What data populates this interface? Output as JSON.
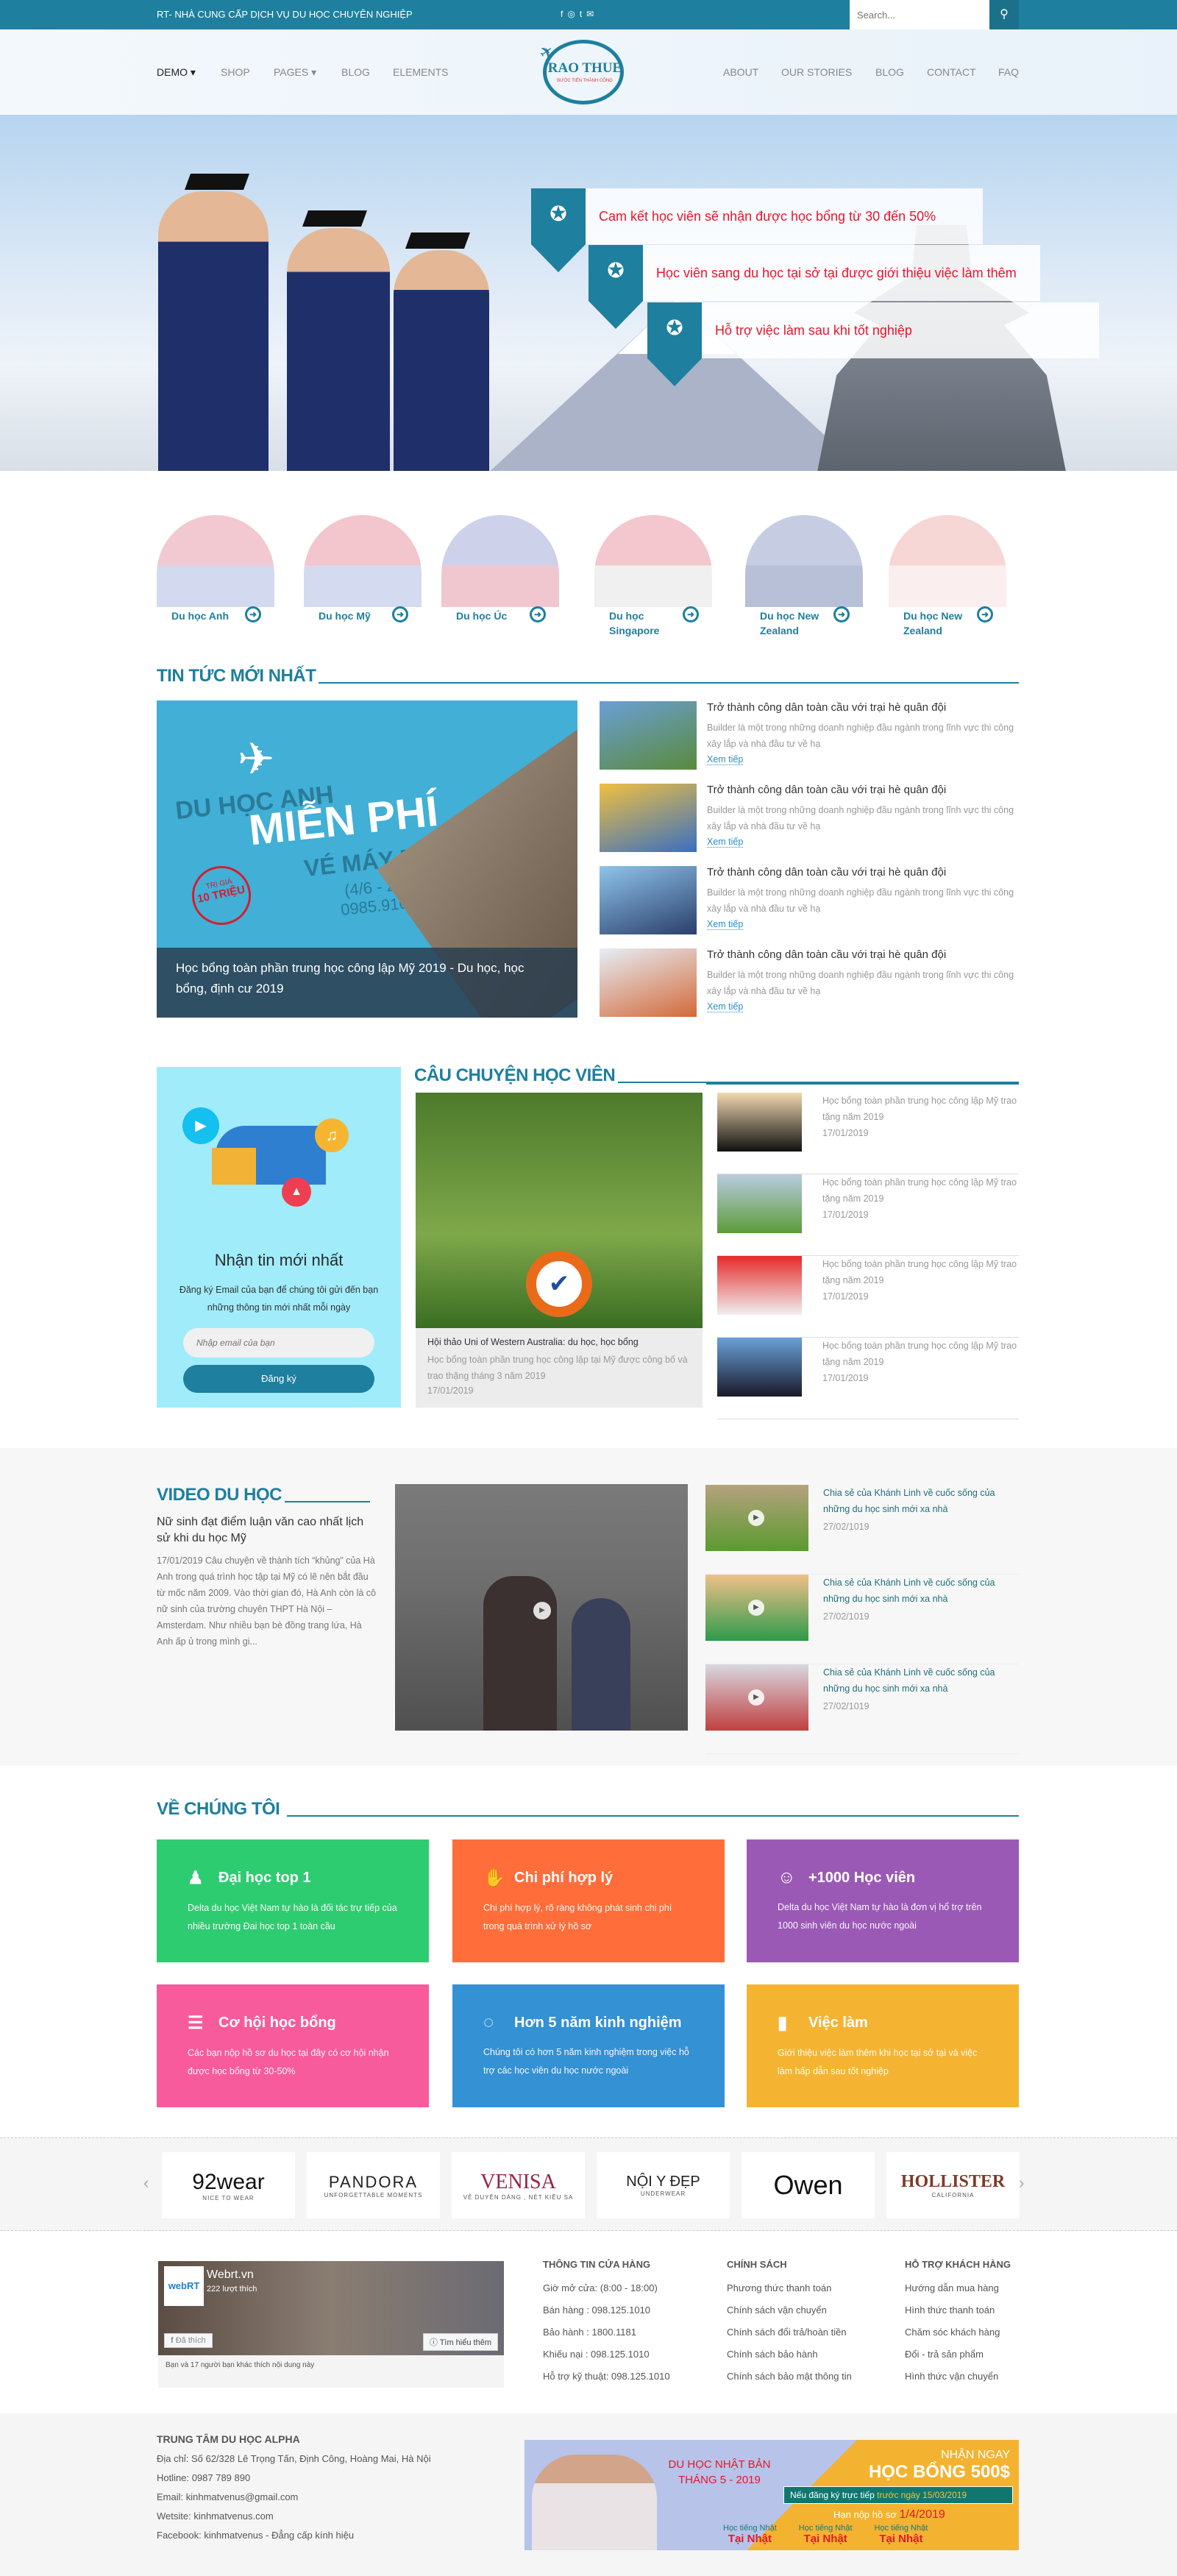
{
  "topbar": {
    "tagline": "RT- NHÀ CUNG CẤP DỊCH VỤ DU HỌC CHUYÊN NGHIỆP",
    "social": [
      "facebook-icon",
      "instagram-icon",
      "twitter-icon",
      "email-icon"
    ],
    "search_placeholder": "Search..."
  },
  "nav": {
    "left": [
      "DEMO",
      "SHOP",
      "PAGES",
      "BLOG",
      "ELEMENTS"
    ],
    "right": [
      "ABOUT",
      "OUR STORIES",
      "BLOG",
      "CONTACT",
      "FAQ"
    ],
    "active": "DEMO"
  },
  "logo": {
    "name": "RAO THUE",
    "slogan": "BƯỚC TIẾN THÀNH CÔNG"
  },
  "hero": {
    "promises": [
      "Cam kết học viên sẽ nhận được học bổng từ 30 đến 50%",
      "Học viên sang du học tại sở tại được giới thiệu việc làm thêm",
      "Hỗ trợ việc làm sau khi tốt nghiệp"
    ]
  },
  "countries": [
    {
      "label": "Du học Anh",
      "colors": [
        "#f2c9d0",
        "#d3d9ee"
      ]
    },
    {
      "label": "Du học Mỹ",
      "colors": [
        "#f3c5cc",
        "#d4daf0"
      ]
    },
    {
      "label": "Du học Úc",
      "colors": [
        "#cdd2ea",
        "#f1c7cf"
      ]
    },
    {
      "label": "Du học Singapore",
      "colors": [
        "#f4c6cd",
        "#f0f0f0"
      ]
    },
    {
      "label": "Du học New Zealand",
      "colors": [
        "#c6cde3",
        "#b8c0d8"
      ]
    },
    {
      "label": "Du học New Zealand",
      "colors": [
        "#f7d6d6",
        "#fbeeee"
      ]
    }
  ],
  "news": {
    "title": "TIN TỨC MỚI NHẤT",
    "featured": {
      "title": "Học bổng toàn phần trung học công lập Mỹ 2019 - Du học, học bổng, định cư 2019",
      "banner": {
        "line1": "DU HỌC ANH",
        "line2": "MIỄN PHÍ",
        "line3": "VÉ MÁY BAY",
        "dates": "(4/6 - 25/6)",
        "phone": "0985.910.334",
        "stamp_top": "TRỊ GIÁ",
        "stamp": "10 TRIỆU"
      }
    },
    "items": [
      {
        "title": "Trở thành công dân toàn cầu với trại hè quân đội",
        "desc": "Builder là một trong những doanh nghiệp đầu ngành trong lĩnh vực thi công xây lắp và nhà đầu tư về hạ",
        "more": "Xem tiếp"
      },
      {
        "title": "Trở thành công dân toàn cầu với trại hè quân đội",
        "desc": "Builder là một trong những doanh nghiệp đầu ngành trong lĩnh vực thi công xây lắp và nhà đầu tư về hạ",
        "more": "Xem tiếp"
      },
      {
        "title": "Trở thành công dân toàn cầu với trại hè quân đội",
        "desc": "Builder là một trong những doanh nghiệp đầu ngành trong lĩnh vực thi công xây lắp và nhà đầu tư về hạ",
        "more": "Xem tiếp"
      },
      {
        "title": "Trở thành công dân toàn cầu với trại hè quân đội",
        "desc": "Builder là một trong những doanh nghiệp đầu ngành trong lĩnh vực thi công xây lắp và nhà đầu tư về hạ",
        "more": "Xem tiếp"
      }
    ]
  },
  "newsletter": {
    "title": "Nhận tin mới nhất",
    "desc": "Đăng ký Email của bạn để chúng tôi gửi đến bạn những thông tin mới nhất mỗi ngày",
    "placeholder": "Nhập email của bạn",
    "button": "Đăng ký"
  },
  "stories": {
    "title": "CÂU CHUYỆN HỌC VIÊN",
    "featured": {
      "title": "Hội thảo Uni of Western Australia: du học, học bổng",
      "desc": "Học bổng toàn phần trung học công lập tại Mỹ được công bố và trao thặng tháng 3 năm 2019",
      "date": "17/01/2019"
    },
    "items": [
      {
        "title": "Học bổng toàn phần trung học công lập Mỹ trao tặng năm 2019",
        "date": "17/01/2019"
      },
      {
        "title": "Học bổng toàn phần trung học công lập Mỹ trao tặng năm 2019",
        "date": "17/01/2019"
      },
      {
        "title": "Học bổng toàn phần trung học công lập Mỹ trao tặng năm 2019",
        "date": "17/01/2019"
      },
      {
        "title": "Học bổng toàn phần trung học công lập Mỹ trao tặng năm 2019",
        "date": "17/01/2019"
      }
    ]
  },
  "video": {
    "title": "VIDEO DU HỌC",
    "headline": "Nữ sinh đạt điểm luận văn cao nhất lịch sử khi du học Mỹ",
    "desc": "17/01/2019 Câu chuyện về thành tích “khủng” của Hà Anh trong quá trình học tập tại Mỹ có lẽ nên bắt đầu từ mốc năm 2009. Vào thời gian đó, Hà Anh còn là cô nữ sinh của trường chuyên THPT Hà Nội – Amsterdam. Như nhiều bạn bè đồng trang lứa, Hà Anh ấp ủ trong mình gi...",
    "items": [
      {
        "title": "Chia sẻ của Khánh Linh về cuốc sống của những du học sinh mới xa nhà",
        "date": "27/02/1019"
      },
      {
        "title": "Chia sẻ của Khánh Linh về cuốc sống của những du học sinh mới xa nhà",
        "date": "27/02/1019"
      },
      {
        "title": "Chia sẻ của Khánh Linh về cuốc sống của những du học sinh mới xa nhà",
        "date": "27/02/1019"
      }
    ]
  },
  "about": {
    "title": "VỀ CHÚNG TÔI",
    "cards": [
      {
        "title": "Đại học top 1",
        "desc": "Delta du học  Việt Nam tự hào là đối tác trự tiếp của nhiều trường Đai học top 1 toàn cầu",
        "icon": "graduate-icon",
        "color": "#2ecc71"
      },
      {
        "title": "Chi phí hợp lý",
        "desc": "Chi phí hợp lý, rõ ràng không phát sinh chi phí trong quá trình xử lý hồ sơ",
        "icon": "payment-icon",
        "color": "#ff6d3a"
      },
      {
        "title": "+1000 Học viên",
        "desc": "Delta du học  Việt Nam tự hào là đơn vị hổ trợ trên 1000 sinh viên du học nước ngoài",
        "icon": "student-reading-icon",
        "color": "#9b59b6"
      },
      {
        "title": "Cơ hội học bổng",
        "desc": "Các bạn nộp hồ sơ du học tại đây có cơ hội nhận được học bổng từ 30-50%",
        "icon": "certificate-icon",
        "color": "#f75b9c"
      },
      {
        "title": "Hơn 5 năm kinh nghiệm",
        "desc": "Chúng tôi có hơn 5 năm kinh nghiệm trong việc hỗ trợ các học viên du học nước ngoài",
        "icon": "ubuntu-icon",
        "color": "#3391d4"
      },
      {
        "title": "Việc làm",
        "desc": "Giới thiệu việc làm thêm khi học tại sở tại và việc làm hấp dẫn sau tốt nghiệp",
        "icon": "growth-chart-icon",
        "color": "#f4b432"
      }
    ]
  },
  "brands": [
    {
      "name": "92wear",
      "sub": "NICE TO WEAR"
    },
    {
      "name": "PANDORA",
      "sub": "UNFORGETTABLE MOMENTS"
    },
    {
      "name": "VENISA",
      "sub": "VẺ DUYÊN DÁNG , NÉT KIỀU SA"
    },
    {
      "name": "NỘI Y ĐẸP",
      "sub": "UNDERWEAR"
    },
    {
      "name": "Owen",
      "sub": ""
    },
    {
      "name": "HOLLISTER",
      "sub": "CALIFORNIA"
    }
  ],
  "facebook": {
    "page": "Webrt.vn",
    "logo": "webRT",
    "likes": "222 lượt thích",
    "liked": "Đã thích",
    "learn_more": "Tìm hiểu thêm",
    "friends": "Bạn và 17 người bạn khác thích nội dung này"
  },
  "footer": {
    "columns": [
      {
        "title": "THÔNG TIN CỬA HÀNG",
        "items": [
          "Giờ mở cửa: (8:00 - 18:00)",
          "Bán hàng : 098.125.1010",
          "Bảo hành : 1800.1181",
          "Khiếu nại : 098.125.1010",
          "Hỗ trợ kỹ thuật: 098.125.1010"
        ]
      },
      {
        "title": "CHÍNH SÁCH",
        "items": [
          "Phương thức thanh toán",
          "Chính sách vận chuyển",
          "Chính sách đổi trả/hoàn tiền",
          "Chính sách bảo hành",
          "Chính sách bảo mật thông tin"
        ]
      },
      {
        "title": "HỖ TRỢ KHÁCH HÀNG",
        "items": [
          "Hướng dẫn mua hàng",
          "Hình thức thanh toán",
          "Chăm sóc khách hàng",
          "Đổi - trả sản phẩm",
          "Hình thức vận chuyển"
        ]
      }
    ],
    "company": {
      "name": "TRUNG TÂM DU HỌC ALPHA",
      "lines": [
        "Địa chỉ: Số 62/328 Lê Trọng Tấn, Định Công, Hoàng Mai, Hà Nội",
        "Hotline: 0987 789 890",
        "Email: kinhmatvenus@gmail.com",
        "Wetsite: kinhmatvenus.com",
        "Facebook: kinhmatvenus - Đẳng cấp kính hiệu"
      ]
    },
    "banner": {
      "l1": "DU HỌC NHẬT BẢN",
      "l2": "THÁNG 5 - 2019",
      "r1": "NHẬN NGAY",
      "r2": "HỌC BỔNG 500$",
      "note": "Nếu đăng ký trực tiếp",
      "note_hl": "trước ngày 15/03/2019",
      "deadline": "Hạn nộp hồ sơ",
      "deadline_date": "1/4/2019",
      "feature": "Học tiếng Nhật",
      "feature_hl": "Tại Nhật"
    }
  }
}
